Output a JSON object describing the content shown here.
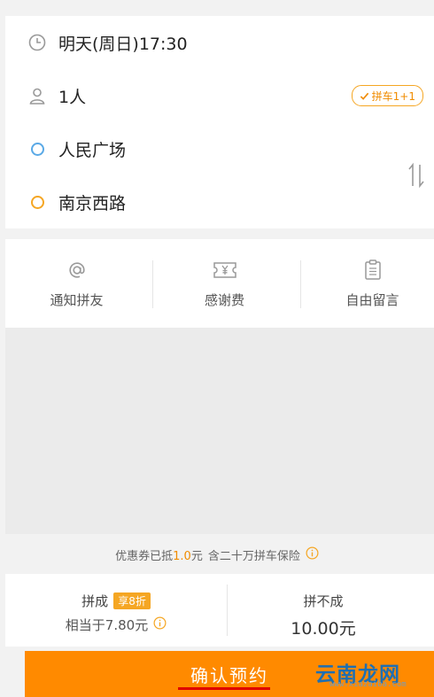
{
  "trip": {
    "time": "明天(周日)17:30",
    "passengers": "1人",
    "carpool_badge": "拼车1+1",
    "origin": "人民广场",
    "destination": "南京西路"
  },
  "actions": {
    "notify_friend": "通知拼友",
    "thanks_fee": "感谢费",
    "free_message": "自由留言"
  },
  "coupon": {
    "prefix": "优惠券已抵",
    "amount": "1.0",
    "unit_suffix": "元",
    "insurance": "含二十万拼车保险"
  },
  "price": {
    "success_label": "拼成",
    "discount_tag": "享8折",
    "equivalent": "相当于7.80元",
    "fail_label": "拼不成",
    "fail_price": "10.00元"
  },
  "confirm_label": "确认预约",
  "watermark": {
    "main": "云南龙网",
    "url": "www.xiazaiba.com"
  },
  "colors": {
    "accent": "#ff8a00",
    "origin_dot": "#5aa9e6",
    "dest_dot": "#f5a623"
  }
}
